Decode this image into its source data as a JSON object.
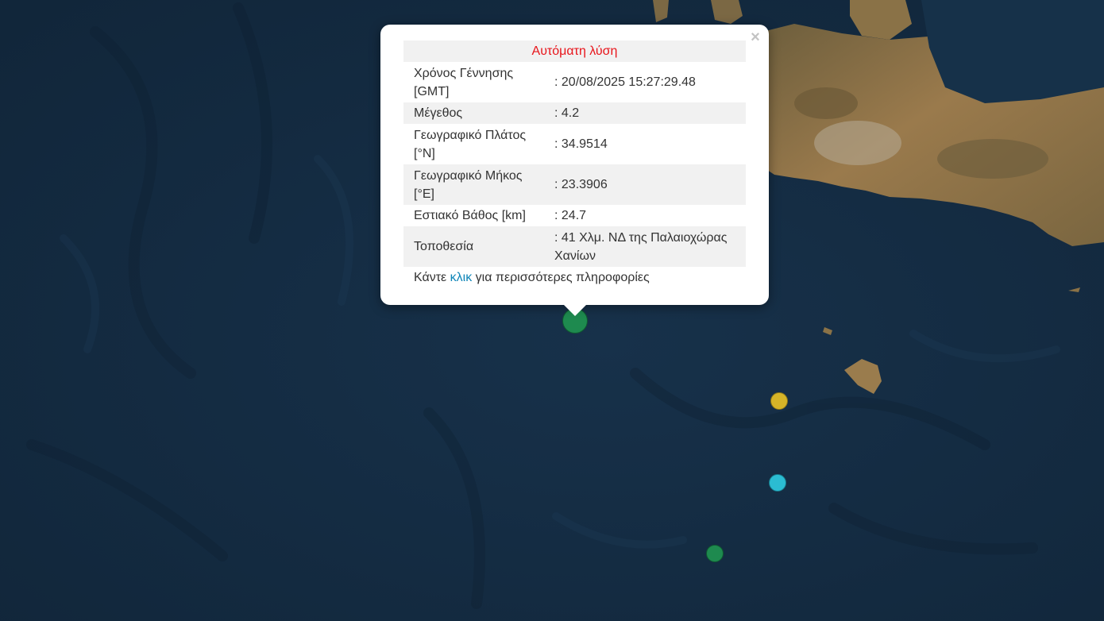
{
  "popup": {
    "title": "Αυτόματη λύση",
    "close_glyph": "×",
    "rows": [
      {
        "label_line1": "Χρόνος Γέννησης",
        "label_line2": "[GMT]",
        "value": ": 20/08/2025 15:27:29.48"
      },
      {
        "label_line1": "Μέγεθος",
        "label_line2": "",
        "value": ": 4.2"
      },
      {
        "label_line1": "Γεωγραφικό Πλάτος",
        "label_line2": "[°N]",
        "value": ": 34.9514"
      },
      {
        "label_line1": "Γεωγραφικό Μήκος",
        "label_line2": "[°E]",
        "value": ": 23.3906"
      },
      {
        "label_line1": "Εστιακό Βάθος [km]",
        "label_line2": "",
        "value": ": 24.7"
      },
      {
        "label_line1": "Τοποθεσία",
        "label_line2": "",
        "value_line1": ": 41 Χλμ. ΝΔ της Παλαιοχώρας",
        "value_line2": "Χανίων"
      }
    ],
    "more_prefix": "Κάντε",
    "more_link": "κλικ",
    "more_suffix": "για περισσότερες πληροφορίες"
  },
  "markers": [
    {
      "name": "selected-earthquake-marker",
      "color": "#1e8a4f"
    },
    {
      "name": "earthquake-marker-yellow",
      "color": "#d6b428"
    },
    {
      "name": "earthquake-marker-cyan",
      "color": "#2bbcd2"
    },
    {
      "name": "earthquake-marker-green",
      "color": "#1e8a4f"
    }
  ],
  "colors": {
    "sea": "#142b40",
    "land": "#8d7249",
    "popup_title": "#e8141a",
    "link": "#0e85b8"
  }
}
